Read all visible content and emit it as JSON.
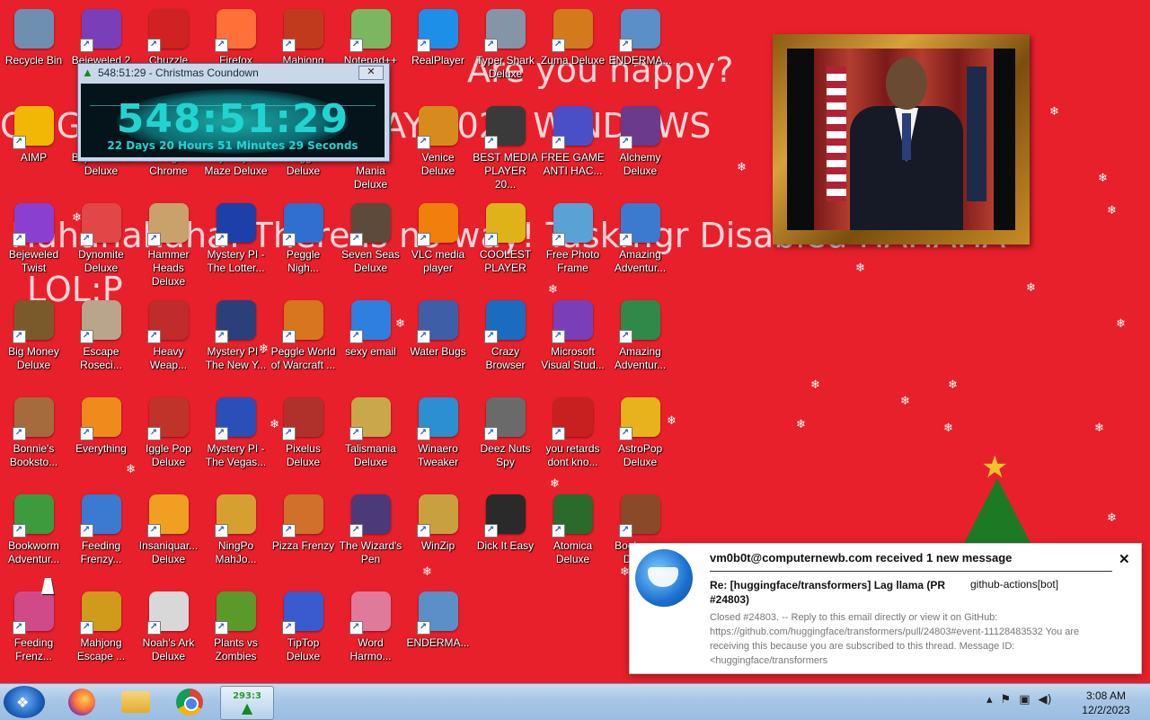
{
  "background_text": {
    "line1": "Are you happy?",
    "line2": "OMG THIS IS NOT TODAY 2024 WINDOWS",
    "line3": "Hahahahaha! There is no way! Taskmgr Disabled HAHAHA",
    "line4": "LOL:P"
  },
  "colors": {
    "desktop_bg": "#e8202b",
    "countdown_text": "#21d4d0",
    "taskbar": "#a7c6e6"
  },
  "icons": [
    {
      "label": "Recycle Bin",
      "icon": "recycle-bin-icon",
      "color": "#6f8fb0"
    },
    {
      "label": "Bejeweled 2 Deluxe",
      "icon": "bejeweled2-icon",
      "color": "#7a3fb8"
    },
    {
      "label": "Chuzzle Deluxe",
      "icon": "chuzzle-icon",
      "color": "#d02222"
    },
    {
      "label": "Firefox",
      "icon": "firefox-icon",
      "color": "#ff7139"
    },
    {
      "label": "Mahjong",
      "icon": "mahjong-icon",
      "color": "#c23a1e"
    },
    {
      "label": "Notepad++",
      "icon": "notepadpp-icon",
      "color": "#7bb661"
    },
    {
      "label": "RealPlayer",
      "icon": "realplayer-icon",
      "color": "#1e8fe8"
    },
    {
      "label": "Typer Shark Deluxe",
      "icon": "typer-shark-icon",
      "color": "#8395a7"
    },
    {
      "label": "Zuma Deluxe",
      "icon": "zuma-icon",
      "color": "#d37a1c"
    },
    {
      "label": "ENDERMA...",
      "icon": "window-icon",
      "color": "#5b8fc7"
    },
    {
      "label": "AIMP",
      "icon": "aimp-icon",
      "color": "#f2b705"
    },
    {
      "label": "Bejeweled 3 Deluxe",
      "icon": "bejeweled3-icon",
      "color": "#c7462f"
    },
    {
      "label": "Google Chrome",
      "icon": "chrome-icon",
      "color": "#1e8f4a"
    },
    {
      "label": "Mystery PI Maze Deluxe",
      "icon": "maze-icon",
      "color": "#2d4fa0"
    },
    {
      "label": "Peggle Deluxe",
      "icon": "peggle-icon",
      "color": "#e06a1a"
    },
    {
      "label": "Rocket Mania Deluxe",
      "icon": "rocket-mania-icon",
      "color": "#1a8a44"
    },
    {
      "label": "Venice Deluxe",
      "icon": "venice-icon",
      "color": "#d68b1c"
    },
    {
      "label": "BEST MEDIA PLAYER 20...",
      "icon": "xmplay-icon",
      "color": "#3a3a3a"
    },
    {
      "label": "FREE GAME ANTI HAC...",
      "icon": "antivirus-icon",
      "color": "#4b4fc7"
    },
    {
      "label": "Alchemy Deluxe",
      "icon": "alchemy-icon",
      "color": "#6b3a8c"
    },
    {
      "label": "Bejeweled Twist",
      "icon": "bejeweled-twist-icon",
      "color": "#8b3fd0"
    },
    {
      "label": "Dynomite Deluxe",
      "icon": "dynomite-icon",
      "color": "#e24646"
    },
    {
      "label": "Hammer Heads Deluxe",
      "icon": "hammer-heads-icon",
      "color": "#c9a16a"
    },
    {
      "label": "Mystery PI - The Lotter...",
      "icon": "mystery-pi-icon",
      "color": "#1c3fa8"
    },
    {
      "label": "Peggle Nigh...",
      "icon": "peggle-nights-icon",
      "color": "#2e6fd0"
    },
    {
      "label": "Seven Seas Deluxe",
      "icon": "seven-seas-icon",
      "color": "#5c4a3a"
    },
    {
      "label": "VLC media player",
      "icon": "vlc-icon",
      "color": "#f07f0e"
    },
    {
      "label": "COOLEST PLAYER",
      "icon": "coolest-player-icon",
      "color": "#e0b21a"
    },
    {
      "label": "Free Photo Frame",
      "icon": "photo-frame-icon",
      "color": "#5aa1d6"
    },
    {
      "label": "Amazing Adventur...",
      "icon": "amazing-adventures-icon",
      "color": "#3c7ad0"
    },
    {
      "label": "Big Money Deluxe",
      "icon": "big-money-icon",
      "color": "#7a5a2a"
    },
    {
      "label": "Escape Roseci...",
      "icon": "escape-rosecliff-icon",
      "color": "#b9a48c"
    },
    {
      "label": "Heavy Weap...",
      "icon": "heavy-weapon-icon",
      "color": "#c02b2b"
    },
    {
      "label": "Mystery PI - The New Y...",
      "icon": "mystery-pi-ny-icon",
      "color": "#2b3f7a"
    },
    {
      "label": "Peggle World of Warcraft ...",
      "icon": "peggle-wow-icon",
      "color": "#d8761f"
    },
    {
      "label": "sexy email",
      "icon": "email-icon",
      "color": "#2f7fe0"
    },
    {
      "label": "Water Bugs",
      "icon": "water-bugs-icon",
      "color": "#3d5fa8"
    },
    {
      "label": "Crazy Browser",
      "icon": "crazy-browser-icon",
      "color": "#1b6cc0"
    },
    {
      "label": "Microsoft Visual Stud...",
      "icon": "visual-studio-icon",
      "color": "#7a3fb8"
    },
    {
      "label": "Amazing Adventur...",
      "icon": "amazing-adventures-2-icon",
      "color": "#2f8a4a"
    },
    {
      "label": "Bonnie's Booksto...",
      "icon": "bonnies-bookstore-icon",
      "color": "#a56b3c"
    },
    {
      "label": "Everything",
      "icon": "everything-icon",
      "color": "#f08a1c"
    },
    {
      "label": "Iggle Pop Deluxe",
      "icon": "iggle-pop-icon",
      "color": "#c0332b"
    },
    {
      "label": "Mystery PI - The Vegas...",
      "icon": "mystery-pi-vegas-icon",
      "color": "#2a4fb8"
    },
    {
      "label": "Pixelus Deluxe",
      "icon": "pixelus-icon",
      "color": "#b0302b"
    },
    {
      "label": "Talismania Deluxe",
      "icon": "talismania-icon",
      "color": "#c8a84a"
    },
    {
      "label": "Winaero Tweaker",
      "icon": "winaero-icon",
      "color": "#2b8fd0"
    },
    {
      "label": "Deez Nuts Spy",
      "icon": "deez-nuts-icon",
      "color": "#6a6a6a"
    },
    {
      "label": "you retards dont kno...",
      "icon": "dino-icon",
      "color": "#c82020"
    },
    {
      "label": "AstroPop Deluxe",
      "icon": "astropop-icon",
      "color": "#e8b21c"
    },
    {
      "label": "Bookworm Adventur...",
      "icon": "bookworm-adv-icon",
      "color": "#3d9a3d"
    },
    {
      "label": "Feeding Frenzy...",
      "icon": "feeding-frenzy-icon",
      "color": "#3a7ad0"
    },
    {
      "label": "Insaniquar... Deluxe",
      "icon": "insaniquarium-icon",
      "color": "#f0a020"
    },
    {
      "label": "NingPo MahJo...",
      "icon": "ningpo-icon",
      "color": "#d6a030"
    },
    {
      "label": "Pizza Frenzy",
      "icon": "pizza-frenzy-icon",
      "color": "#d0702a"
    },
    {
      "label": "The Wizard's Pen",
      "icon": "wizards-pen-icon",
      "color": "#4a3a7a"
    },
    {
      "label": "WinZip",
      "icon": "winzip-icon",
      "color": "#c8a040"
    },
    {
      "label": "Dick It Easy",
      "icon": "dick-it-easy-icon",
      "color": "#2a2a2a"
    },
    {
      "label": "Atomica Deluxe",
      "icon": "atomica-icon",
      "color": "#2a6a2a"
    },
    {
      "label": "Bookworm Deluxe",
      "icon": "bookworm-icon",
      "color": "#8a4a2a"
    },
    {
      "label": "Feeding Frenz...",
      "icon": "feeding-frenzy-2-icon",
      "color": "#d04a8a"
    },
    {
      "label": "Mahjong Escape ...",
      "icon": "mahjong-escape-icon",
      "color": "#d09a1a"
    },
    {
      "label": "Noah's Ark Deluxe",
      "icon": "noahs-ark-icon",
      "color": "#d8d8d8"
    },
    {
      "label": "Plants vs Zombies",
      "icon": "pvz-icon",
      "color": "#5a9a2a"
    },
    {
      "label": "TipTop Deluxe",
      "icon": "tiptop-icon",
      "color": "#3a5ad0"
    },
    {
      "label": "Word Harmo...",
      "icon": "word-harmony-icon",
      "color": "#e07a9a"
    },
    {
      "label": "ENDERMA...",
      "icon": "window-2-icon",
      "color": "#5b8fc7"
    }
  ],
  "countdown_window": {
    "title": "548:51:29 - Christmas Coundown",
    "close_label": "✕",
    "time": "548:51:29",
    "subtitle": "22 Days 20 Hours 51 Minutes 29 Seconds"
  },
  "notification": {
    "title": "vm0b0t@computernewb.com received 1 new message",
    "close_label": "✕",
    "subject": "Re: [huggingface/transformers] Lag llama (PR #24803)",
    "sender": "github-actions[bot]",
    "body": "Closed #24803. -- Reply to this email directly or view it on GitHub: https://github.com/huggingface/transformers/pull/24803#event-11128483532 You are receiving this because you are subscribed to this thread. Message ID: <huggingface/transformers"
  },
  "taskbar": {
    "countdown_badge": "293:3",
    "tray_icons": [
      "show-hidden-icon",
      "action-center-icon",
      "network-icon",
      "volume-icon"
    ],
    "time": "3:08 AM",
    "date": "12/2/2023"
  }
}
